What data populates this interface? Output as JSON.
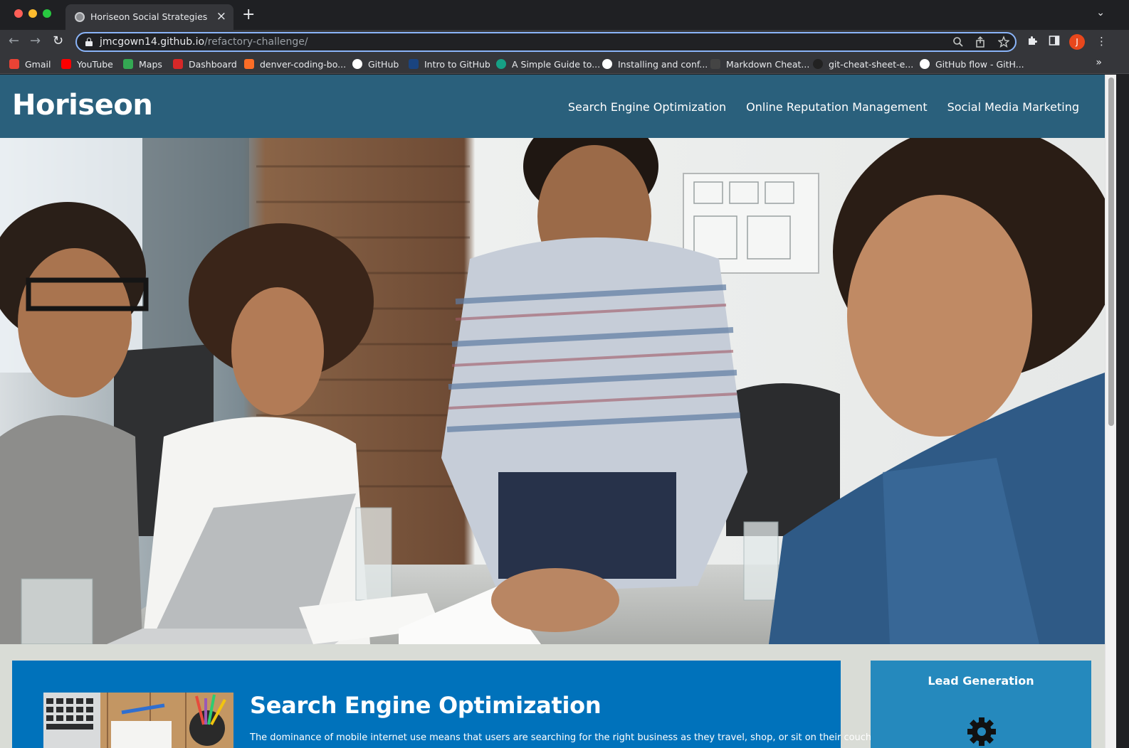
{
  "browser": {
    "tab_title": "Horiseon Social Strategies",
    "tab_close": "×",
    "new_tab": "+",
    "url_host": "jmcgown14.github.io",
    "url_path": "/refactory-challenge/",
    "avatar_letter": "J",
    "bookmarks": [
      {
        "label": "Gmail",
        "icon": "gmail-icon",
        "color": "#ea4335"
      },
      {
        "label": "YouTube",
        "icon": "youtube-icon",
        "color": "#ff0000"
      },
      {
        "label": "Maps",
        "icon": "maps-icon",
        "color": "#34a853"
      },
      {
        "label": "Dashboard",
        "icon": "dashboard-icon",
        "color": "#d62828"
      },
      {
        "label": "denver-coding-bo...",
        "icon": "gitlab-icon",
        "color": "#fc6d26"
      },
      {
        "label": "GitHub",
        "icon": "github-icon",
        "color": "#ffffff"
      },
      {
        "label": "Intro to GitHub",
        "icon": "gsa-icon",
        "color": "#1a4480"
      },
      {
        "label": "A Simple Guide to...",
        "icon": "guide-icon",
        "color": "#16a085"
      },
      {
        "label": "Installing and conf...",
        "icon": "github-icon",
        "color": "#ffffff"
      },
      {
        "label": "Markdown Cheat...",
        "icon": "markdown-icon",
        "color": "#444444"
      },
      {
        "label": "git-cheat-sheet-e...",
        "icon": "github-icon",
        "color": "#222222"
      },
      {
        "label": "GitHub flow - GitH...",
        "icon": "github-icon",
        "color": "#ffffff"
      }
    ],
    "bookmarks_more": "»"
  },
  "site": {
    "logo": "Horiseon",
    "nav": [
      {
        "label": "Search Engine Optimization"
      },
      {
        "label": "Online Reputation Management"
      },
      {
        "label": "Social Media Marketing"
      }
    ],
    "section_title": "Search Engine Optimization",
    "section_text": "The dominance of mobile internet use means that users are searching for the right business as they travel, shop, or sit on their couch at",
    "sidebar_title": "Lead Generation"
  },
  "colors": {
    "header": "#2a607c",
    "content_bg": "#0072bb",
    "sidebar_bg": "#2589bd",
    "page_bg": "#d9dcd6"
  }
}
